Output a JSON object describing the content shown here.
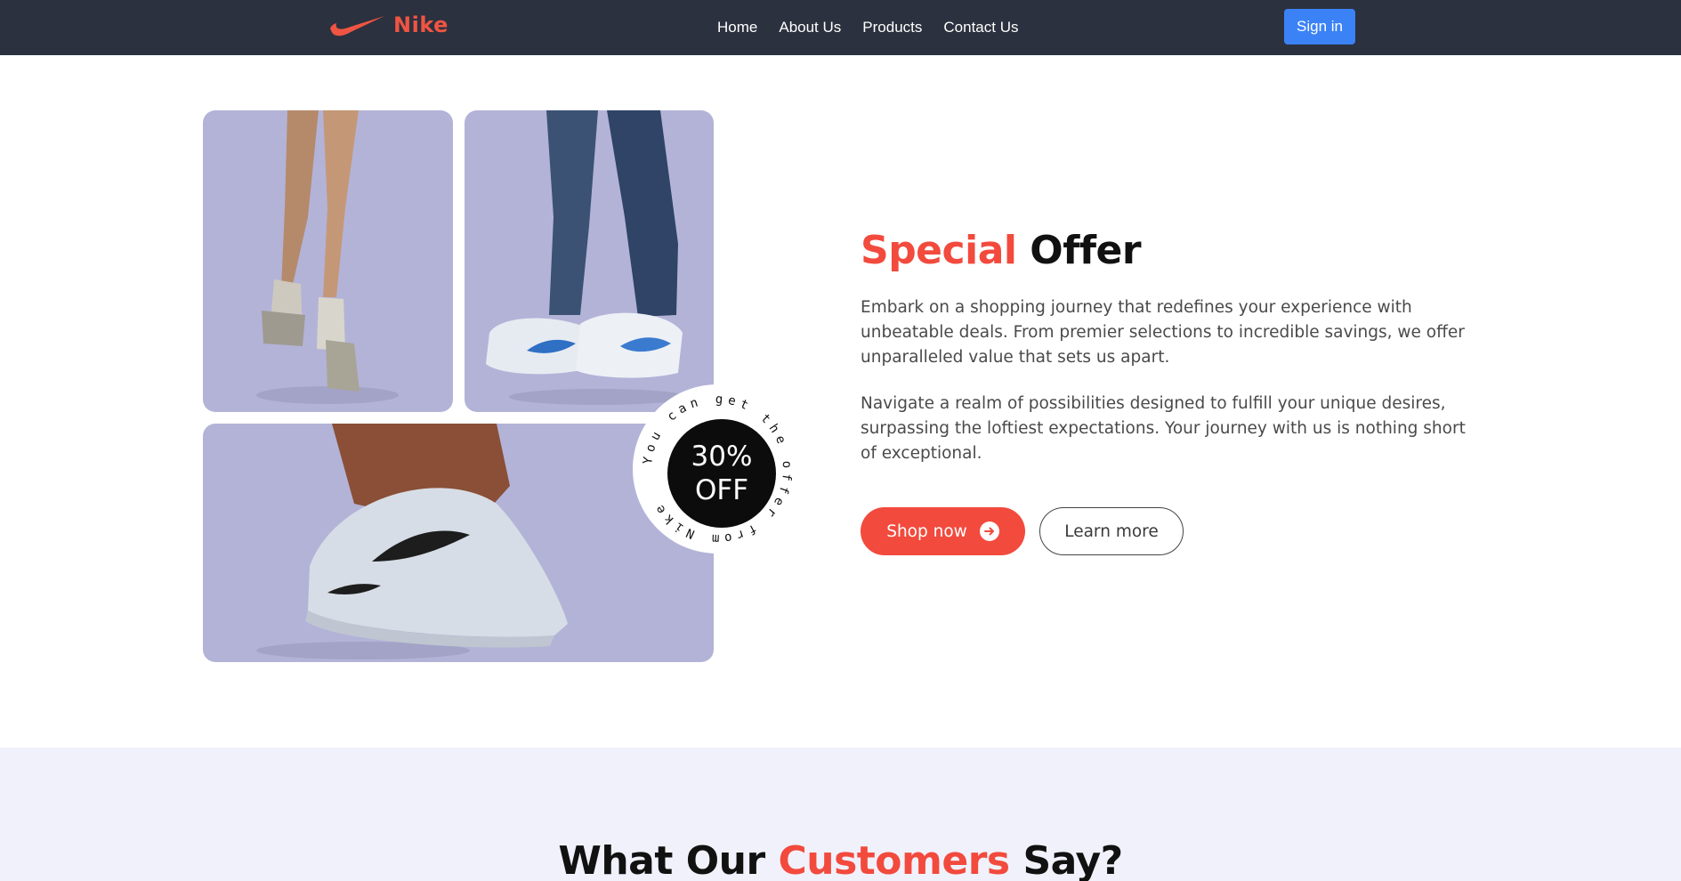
{
  "nav": {
    "brand": "Nike",
    "links": [
      "Home",
      "About Us",
      "Products",
      "Contact Us"
    ],
    "signin": "Sign in"
  },
  "offer": {
    "title_accent": "Special",
    "title_rest": "Offer",
    "paragraphs": [
      "Embark on a shopping journey that redefines your experience with unbeatable deals. From premier selections to incredible savings, we offer unparalleled value that sets us apart.",
      "Navigate a realm of possibilities designed to fulfill your unique desires, surpassing the loftiest expectations. Your journey with us is nothing short of exceptional."
    ],
    "shop_button": "Shop now",
    "learn_button": "Learn more"
  },
  "badge": {
    "percent": "30%",
    "off": "OFF",
    "ring_text": "You can get the offer from Nike"
  },
  "testimonials": {
    "title_a": "What Our",
    "title_accent": "Customers",
    "title_b": "Say?"
  },
  "colors": {
    "navbar": "#2b313e",
    "accent": "#f24a3d",
    "signin": "#3b82f6",
    "tile": "#b3b3d8",
    "testimonials_bg": "#f1f1fb"
  },
  "icons": [
    "nike-swoosh-logo",
    "arrow-right-circle-icon"
  ]
}
